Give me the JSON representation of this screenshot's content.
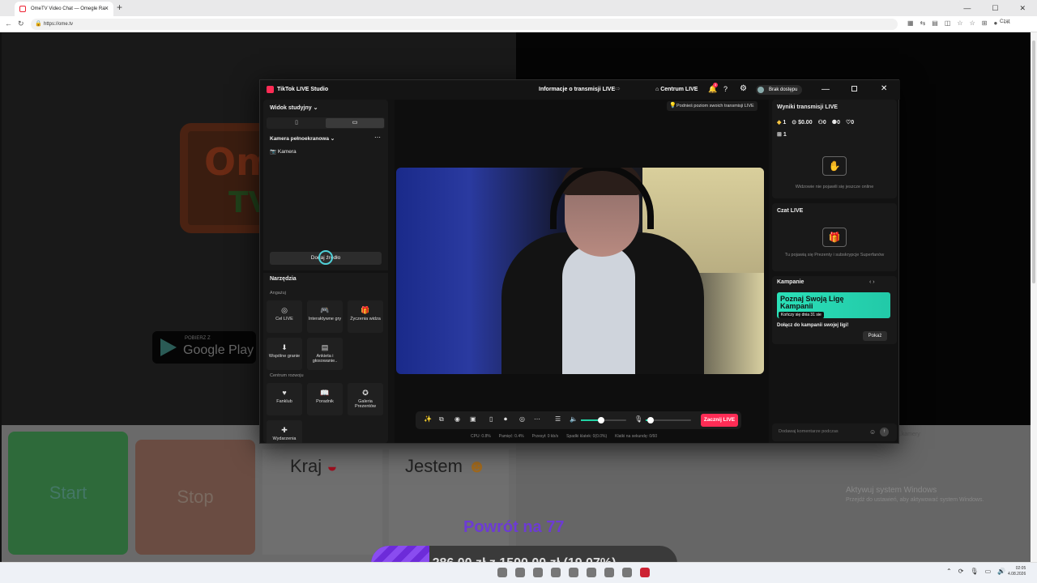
{
  "browser": {
    "tab_title": "OmeTV Video Chat — Omegle Ra",
    "url": "https://ome.tv",
    "copilot_label": "Czat"
  },
  "ometv": {
    "logo_text_1": "Ome",
    "logo_text_2": "TV",
    "gplay_small": "POBIERZ Z",
    "gplay_big": "Google Play",
    "start_label": "Start",
    "stop_label": "Stop",
    "country_label": "Kraj",
    "gender_label": "Jestem",
    "chat_hint": "...kamery"
  },
  "windows": {
    "activate_title": "Aktywuj system Windows",
    "activate_sub": "Przejdź do ustawień, aby aktywować system Windows.",
    "clock_time": "02:05",
    "clock_date": "4.08.2026"
  },
  "overlay": {
    "title": "Powrót na 77",
    "donation_text": "286,00 zł z 1500,00 zł (19.07%)",
    "donation_fraction": 0.1907
  },
  "tts": {
    "app_name": "TikTok LIVE Studio",
    "info_title": "Informacje o transmisji LIVE",
    "centrum_label": "Centrum LIVE",
    "notif_count": "3",
    "user_label": "Brak dostępu",
    "left": {
      "view_label": "Widok studyjny",
      "scene_label": "Kamera pełnoekranowa",
      "source_label": "Kamera",
      "add_source": "Dodaj źródło",
      "tools_title": "Narzędzia",
      "engage_label": "Angażuj",
      "growth_label": "Centrum rozwoju",
      "engage_tools": [
        {
          "icon": "◎",
          "label": "Cel LIVE"
        },
        {
          "icon": "🎮",
          "label": "Interaktywne gry"
        },
        {
          "icon": "🎁",
          "label": "Życzenia widza"
        },
        {
          "icon": "⬇",
          "label": "Wspólne granie"
        },
        {
          "icon": "▤",
          "label": "Ankieta i głosowanie.."
        }
      ],
      "growth_tools": [
        {
          "icon": "♥",
          "label": "Fanklub"
        },
        {
          "icon": "📖",
          "label": "Poradnik"
        },
        {
          "icon": "✪",
          "label": "Galeria Prezentów"
        },
        {
          "icon": "✚",
          "label": "Wydarzenia"
        }
      ]
    },
    "preview": {
      "tip": "Podnieś poziom swoich transmisji LIVE",
      "go_live": "Zacznij LIVE",
      "volume_level": 0.45,
      "mic_level": 0.1,
      "stats": [
        "CPU: 0.8%",
        "Pamięć: 0.4%",
        "Przesył: 0 kb/s",
        "Spadki klatek: 0(0.0%)",
        "Klatki na sekundę: 0/60"
      ]
    },
    "right": {
      "results_title": "Wyniki transmisji LIVE",
      "results_stats": [
        "1",
        "$0.00",
        "0",
        "0",
        "0"
      ],
      "gifts": "1",
      "viewers_note": "Widzowie nie pojawili się jeszcze online",
      "chat_title": "Czat LIVE",
      "chat_note": "Tu pojawią się Prezenty i subskrypcje Superfanów",
      "campaign_title": "Kampanie",
      "campaign_banner": "Poznaj Swoją Ligę Kampanii",
      "campaign_banner_sub": "Kończy się dnia 31 sie",
      "campaign_text": "Dołącz do kampanii swojej ligi!",
      "campaign_button": "Pokaż",
      "comment_placeholder": "Dodawaj komentarze podczas"
    }
  }
}
